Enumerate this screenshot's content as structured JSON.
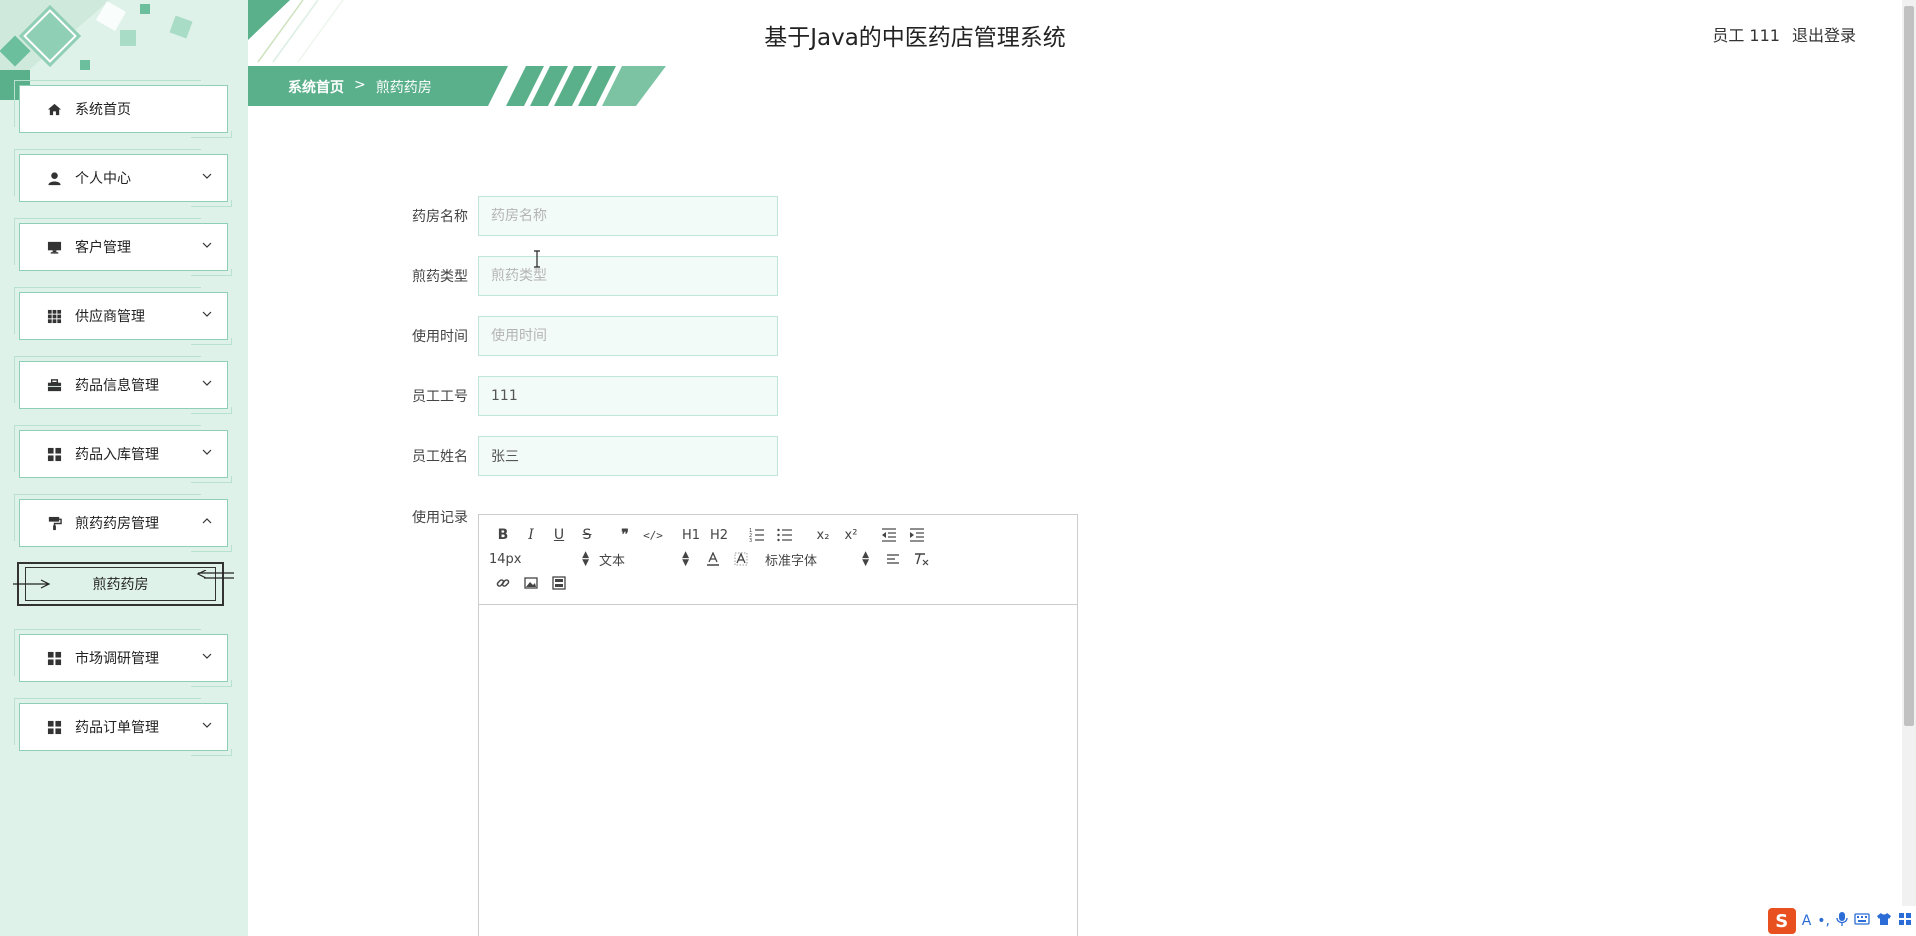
{
  "app": {
    "title": "基于Java的中医药店管理系统"
  },
  "header": {
    "user_label": "员工 111",
    "logout_label": "退出登录"
  },
  "breadcrumb": {
    "home": "系统首页",
    "separator": ">",
    "current": "煎药药房"
  },
  "sidebar": {
    "items": [
      {
        "label": "系统首页",
        "icon": "home-icon"
      },
      {
        "label": "个人中心",
        "icon": "user-icon"
      },
      {
        "label": "客户管理",
        "icon": "monitor-icon"
      },
      {
        "label": "供应商管理",
        "icon": "grid-icon"
      },
      {
        "label": "药品信息管理",
        "icon": "briefcase-icon"
      },
      {
        "label": "药品入库管理",
        "icon": "apps-icon"
      },
      {
        "label": "煎药药房管理",
        "icon": "paint-roller-icon",
        "expanded": true
      },
      {
        "label": "市场调研管理",
        "icon": "apps-icon"
      },
      {
        "label": "药品订单管理",
        "icon": "apps-icon"
      }
    ],
    "active_sub_item": "煎药药房"
  },
  "form": {
    "pharmacy_name": {
      "label": "药房名称",
      "placeholder": "药房名称",
      "value": ""
    },
    "decoct_type": {
      "label": "煎药类型",
      "placeholder": "煎药类型",
      "value": ""
    },
    "use_time": {
      "label": "使用时间",
      "placeholder": "使用时间",
      "value": ""
    },
    "employee_no": {
      "label": "员工工号",
      "placeholder": "",
      "value": "111"
    },
    "employee_name": {
      "label": "员工姓名",
      "placeholder": "",
      "value": "张三"
    },
    "usage_record": {
      "label": "使用记录"
    }
  },
  "editor": {
    "row1": [
      "B",
      "I",
      "U",
      "S",
      "❞",
      "</>",
      "H1",
      "H2",
      "ol",
      "ul",
      "x₂",
      "x²",
      "outdent",
      "indent"
    ],
    "font_size": "14px",
    "paragraph": "文本",
    "font_family": "标准字体"
  },
  "colors": {
    "sidebar_bg": "#dff2ea",
    "accent": "#5bb08c",
    "input_bg": "#f2fbf7",
    "input_border": "#bfe6d6"
  }
}
